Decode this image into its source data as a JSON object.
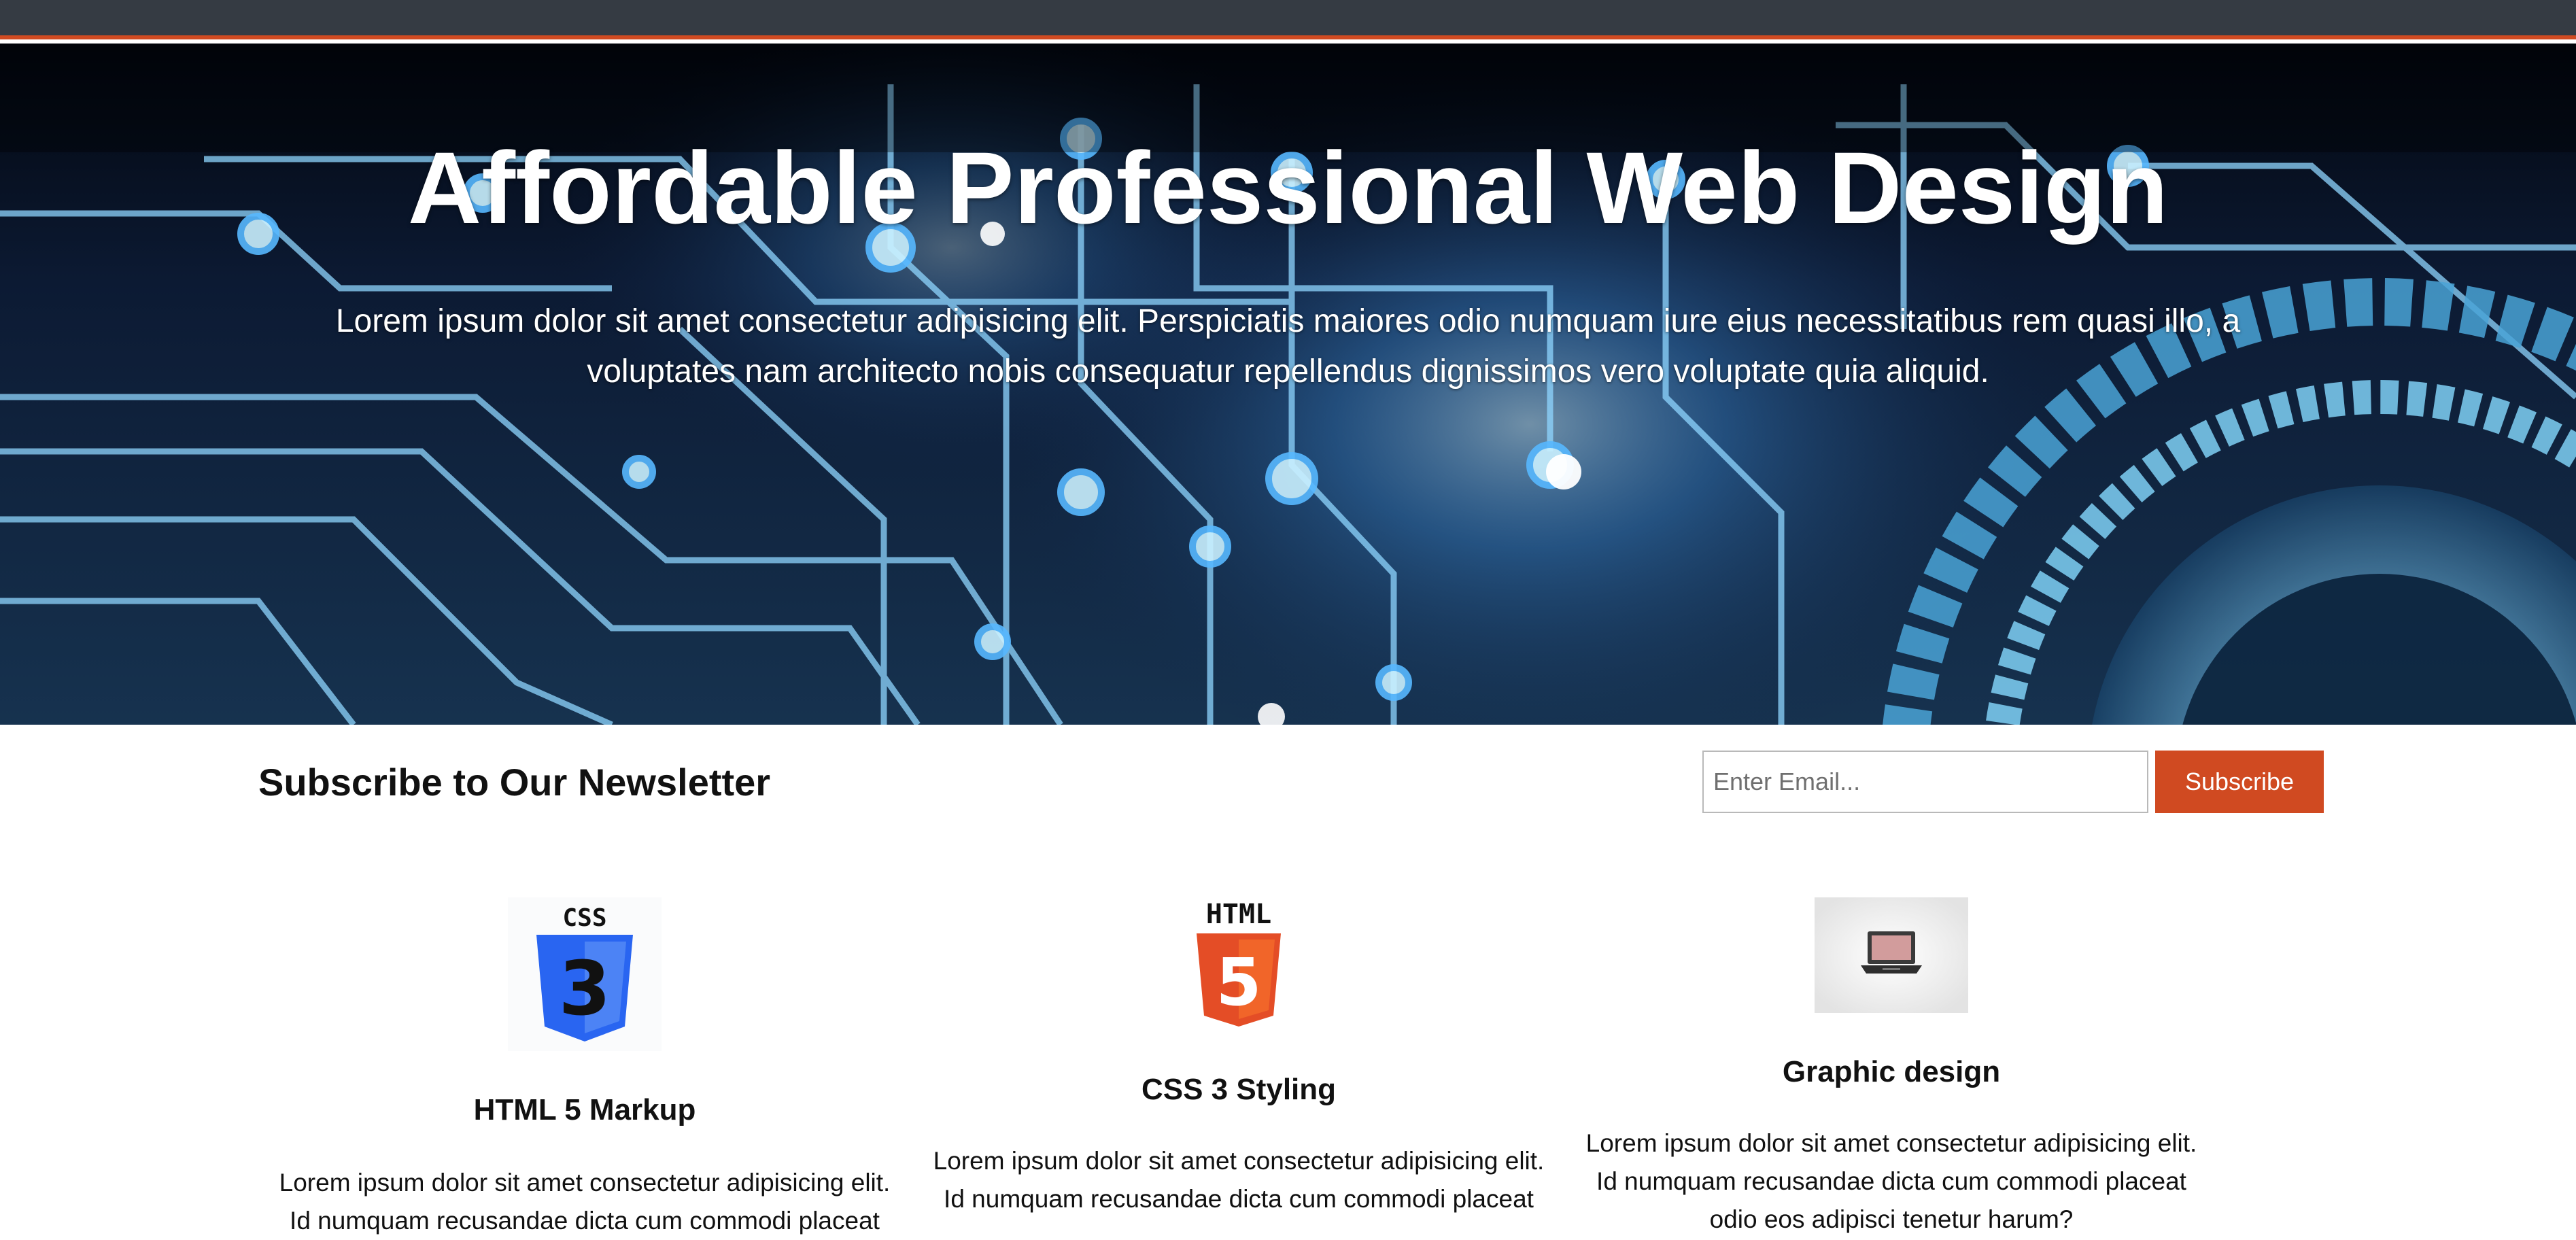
{
  "hero": {
    "title": "Affordable Professional Web Design",
    "text": "Lorem ipsum dolor sit amet consectetur adipisicing elit. Perspiciatis maiores odio numquam iure eius necessitatibus rem quasi illo, a voluptates nam architecto nobis consequatur repellendus dignissimos vero voluptate quia aliquid."
  },
  "newsletter": {
    "title": "Subscribe to Our Newsletter",
    "email_placeholder": "Enter Email...",
    "button_label": "Subscribe"
  },
  "features": [
    {
      "icon": "css3-logo-icon",
      "logo_text": "CSS",
      "logo_number": "3",
      "title": "HTML 5 Markup",
      "text": "Lorem ipsum dolor sit amet consectetur adipisicing elit. Id numquam recusandae dicta cum commodi placeat"
    },
    {
      "icon": "html5-logo-icon",
      "logo_text": "HTML",
      "logo_number": "5",
      "title": "CSS 3 Styling",
      "text": "Lorem ipsum dolor sit amet consectetur adipisicing elit. Id numquam recusandae dicta cum commodi placeat"
    },
    {
      "icon": "laptop-icon",
      "title": "Graphic design",
      "text": "Lorem ipsum dolor sit amet consectetur adipisicing elit. Id numquam recusandae dicta cum commodi placeat odio eos adipisci tenetur harum?"
    }
  ],
  "colors": {
    "accent": "#d04a21",
    "topbar": "#353b43",
    "css_blue": "#2965f1",
    "html_orange": "#e44d26"
  }
}
